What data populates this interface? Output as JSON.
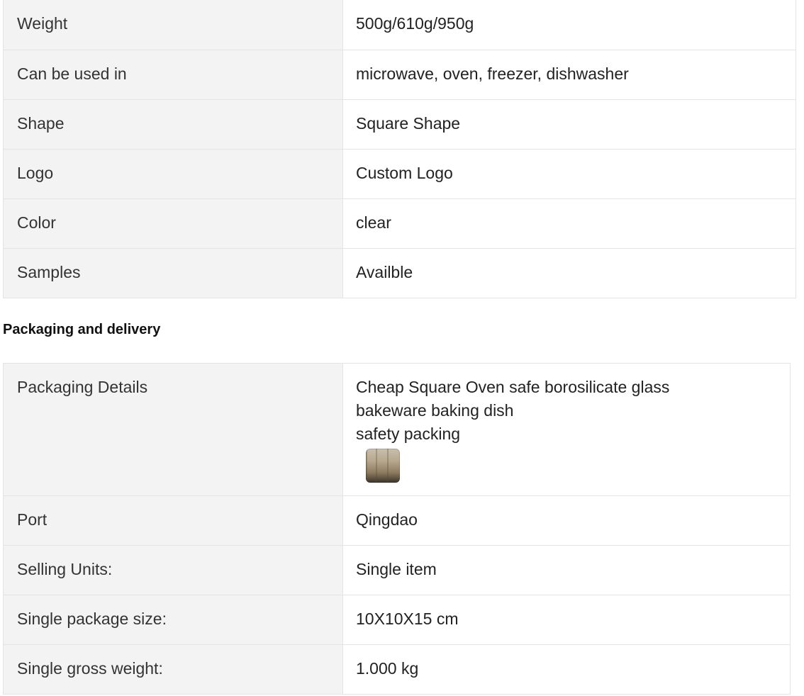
{
  "attributes": {
    "rows": [
      {
        "label": "Weight",
        "value": "500g/610g/950g"
      },
      {
        "label": "Can be used in",
        "value": "microwave, oven, freezer, dishwasher"
      },
      {
        "label": "Shape",
        "value": "Square Shape"
      },
      {
        "label": "Logo",
        "value": "Custom Logo"
      },
      {
        "label": "Color",
        "value": "clear"
      },
      {
        "label": "Samples",
        "value": "Availble"
      }
    ]
  },
  "packaging": {
    "heading": "Packaging and delivery",
    "details": {
      "label": "Packaging Details",
      "lines": [
        "Cheap Square Oven safe borosilicate glass",
        "bakeware baking dish",
        "safety packing"
      ],
      "thumbnail_icon": "package-photo-thumbnail"
    },
    "rows": [
      {
        "label": "Port",
        "value": "Qingdao"
      },
      {
        "label": "Selling Units:",
        "value": "Single item"
      },
      {
        "label": "Single package size:",
        "value": "10X10X15 cm"
      },
      {
        "label": "Single gross weight:",
        "value": "1.000 kg"
      }
    ]
  }
}
